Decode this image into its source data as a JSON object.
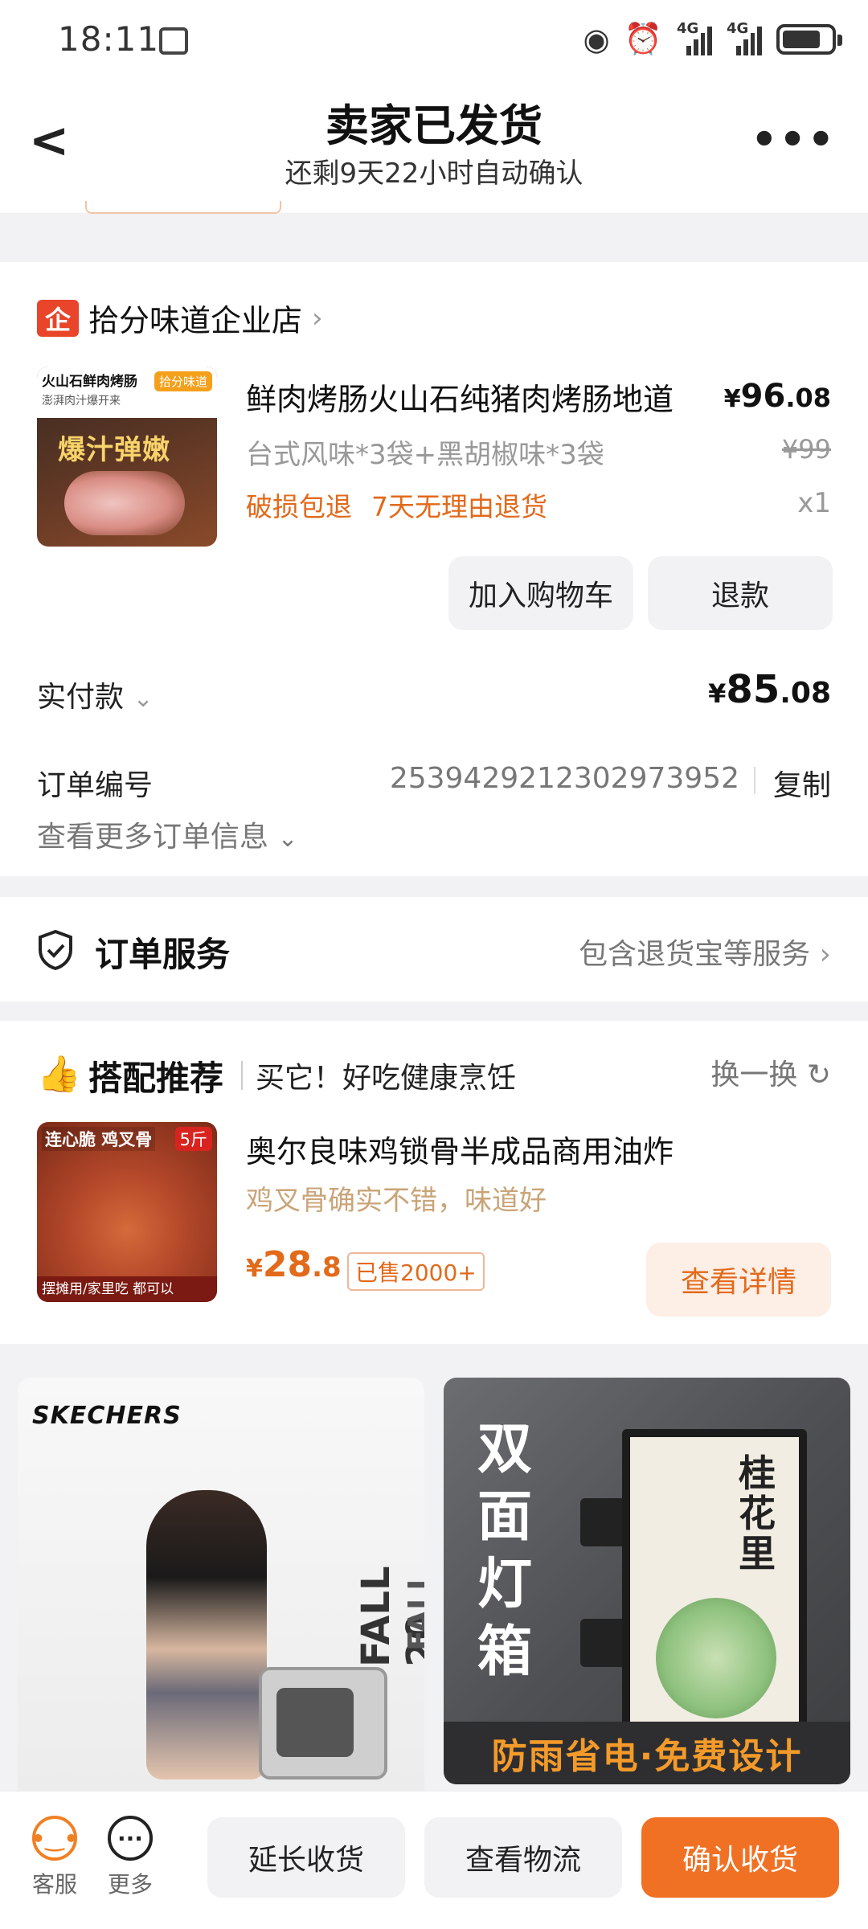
{
  "status_bar": {
    "time": "18:11",
    "network_1": "4G",
    "network_2": "4G"
  },
  "header": {
    "title": "卖家已发货",
    "subtitle": "还剩9天22小时自动确认"
  },
  "shop": {
    "logo_char": "企",
    "name": "拾分味道企业店"
  },
  "product": {
    "title": "鲜肉烤肠火山石纯猪肉烤肠地道",
    "price_currency": "¥",
    "price_int": "96",
    "price_dec": ".08",
    "spec": "台式风味*3袋+黑胡椒味*3袋",
    "original_price": "¥99",
    "tags": [
      "破损包退",
      "7天无理由退货"
    ],
    "qty": "x1",
    "image": {
      "line1": "火山石鲜肉烤肠",
      "line2": "澎湃肉汁爆开来",
      "brand_badge": "拾分味道",
      "slogan": "爆汁弹嫩"
    }
  },
  "actions": {
    "add_cart": "加入购物车",
    "refund": "退款"
  },
  "payment": {
    "label": "实付款",
    "currency": "¥",
    "amount_int": "85",
    "amount_dec": ".08"
  },
  "order": {
    "number_label": "订单编号",
    "number": "2539429212302973952",
    "copy": "复制",
    "more_info": "查看更多订单信息"
  },
  "service": {
    "title": "订单服务",
    "desc": "包含退货宝等服务"
  },
  "recommend": {
    "title": "搭配推荐",
    "subtitle": "买它！好吃健康烹饪",
    "change": "换一换",
    "item": {
      "name": "奥尔良味鸡锁骨半成品商用油炸",
      "desc": "鸡叉骨确实不错，味道好",
      "price_currency": "¥",
      "price_int": "28",
      "price_dec": ".8",
      "sold": "已售2000+",
      "detail_button": "查看详情",
      "image": {
        "tag1": "连心脆 鸡叉骨",
        "tag2": "5斤",
        "tag3": "摆摊用/家里吃  都可以"
      }
    }
  },
  "ads": {
    "left": {
      "brand": "SKECHERS",
      "fall_1": "FALL 20",
      "fall_2": "FALL 2020"
    },
    "right": {
      "vertical_text": "双面灯箱",
      "sign_text": "桂花里",
      "bottom_text": "防雨省电·免费设计"
    }
  },
  "bottom_bar": {
    "service_label": "客服",
    "more_label": "更多",
    "extend": "延长收货",
    "logistics": "查看物流",
    "confirm": "确认收货"
  },
  "colors": {
    "accent": "#f07124",
    "tag_orange": "#e26a1b",
    "shop_red": "#e8452b",
    "background": "#f2f2f4"
  }
}
